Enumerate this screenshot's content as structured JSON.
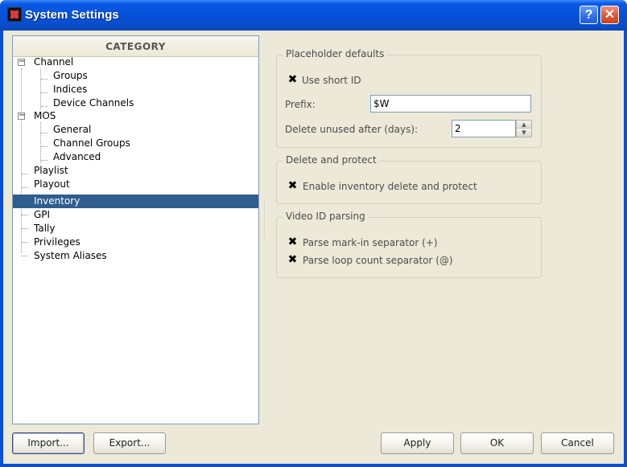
{
  "window": {
    "title": "System Settings",
    "help_label": "?",
    "close_label": "✕"
  },
  "sidebar": {
    "header": "CATEGORY",
    "items": [
      {
        "label": "Channel",
        "expanded": true
      },
      {
        "label": "Groups"
      },
      {
        "label": "Indices"
      },
      {
        "label": "Device Channels"
      },
      {
        "label": "MOS",
        "expanded": true
      },
      {
        "label": "General"
      },
      {
        "label": "Channel Groups"
      },
      {
        "label": "Advanced"
      },
      {
        "label": "Playlist"
      },
      {
        "label": "Playout"
      },
      {
        "label": "Inventory",
        "selected": true
      },
      {
        "label": "GPI"
      },
      {
        "label": "Tally"
      },
      {
        "label": "Privileges"
      },
      {
        "label": "System Aliases"
      }
    ],
    "expander_symbol": "−"
  },
  "placeholder": {
    "title": "Placeholder defaults",
    "use_short_id_label": "Use short ID",
    "use_short_id_checked": true,
    "prefix_label": "Prefix:",
    "prefix_value": "$W",
    "delete_unused_label": "Delete unused after (days):",
    "delete_unused_value": "2"
  },
  "delete_protect": {
    "title": "Delete and protect",
    "enable_label": "Enable inventory delete and protect",
    "enable_checked": true
  },
  "video_id": {
    "title": "Video ID parsing",
    "markin_label": "Parse mark-in separator (+)",
    "markin_checked": true,
    "loop_label": "Parse loop count separator (@)",
    "loop_checked": true
  },
  "check_mark": "✖",
  "spin": {
    "up": "▲",
    "down": "▼"
  },
  "buttons": {
    "import": "Import...",
    "export": "Export...",
    "apply": "Apply",
    "ok": "OK",
    "cancel": "Cancel"
  },
  "colors": {
    "titlebar": "#0550d8",
    "selection": "#2f5d8e",
    "dialog_bg": "#ece9d8"
  }
}
